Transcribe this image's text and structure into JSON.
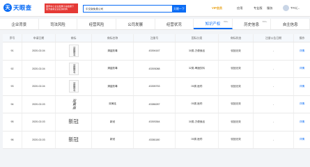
{
  "header": {
    "logo_char": "天",
    "logo_text": "天眼查",
    "promo_line1": "国家中小企业发展子基金旗下",
    "promo_line2": "官方备案企业征信机构",
    "search_value": "中文版免费公司",
    "search_button": "天眼一下",
    "nav": [
      "VIP会员",
      "应用",
      "专业版",
      "服务",
      "我的"
    ],
    "user_name": "TYC(..."
  },
  "tabs": [
    {
      "label": "企业背景",
      "badge": ""
    },
    {
      "label": "司法风险",
      "badge": ""
    },
    {
      "label": "经营风险",
      "badge": ""
    },
    {
      "label": "公司发展",
      "badge": ""
    },
    {
      "label": "经营状况",
      "badge": ""
    },
    {
      "label": "知识产权",
      "badge": "999+"
    },
    {
      "label": "历史信息",
      "badge": "999+"
    },
    {
      "label": "自主信息",
      "badge": ""
    }
  ],
  "active_tab": 5,
  "table": {
    "columns": [
      "序号",
      "申请日期",
      "商标",
      "商标名称",
      "注册号",
      "国际分类",
      "商标状态",
      "注册公告日期",
      "操作"
    ],
    "rows": [
      {
        "index": "91",
        "date": "2020-02-04",
        "mark": "清瘟败毒",
        "mark_style": "box",
        "name": "清瘟败毒",
        "reg": "43394167",
        "cls": "30类-方便食品",
        "status": "驳回无效",
        "notice": "-",
        "action": "详情"
      },
      {
        "index": "92",
        "date": "2020-02-04",
        "mark": "清瘟败毒",
        "mark_style": "box",
        "name": "清瘟败毒",
        "reg": "43393088",
        "cls": "32类-啤酒饮料",
        "status": "驳回无效",
        "notice": "-",
        "action": "详情"
      },
      {
        "index": "93",
        "date": "2020-02-04",
        "mark": "清瘟败毒",
        "mark_style": "box",
        "name": "清瘟败毒",
        "reg": "43395753",
        "cls": "05类-医药",
        "status": "驳回无效",
        "notice": "-",
        "action": "详情"
      },
      {
        "index": "94",
        "date": "2020-02-03",
        "mark": "双黄连",
        "mark_style": "calligraphy",
        "name": "双黄连",
        "reg": "43386287",
        "cls": "05类-医药",
        "status": "驳回无效",
        "notice": "-",
        "action": "详情"
      },
      {
        "index": "95",
        "date": "2020-02-03",
        "mark": "新冠",
        "mark_style": "big",
        "name": "新冠",
        "reg": "43393364",
        "cls": "30类-方便食品",
        "status": "驳回无效",
        "notice": "-",
        "action": "详情"
      },
      {
        "index": "96",
        "date": "2020-02-03",
        "mark": "新冠",
        "mark_style": "big",
        "name": "新冠",
        "reg": "43381180",
        "cls": "05类-医药",
        "status": "驳回无效",
        "notice": "-",
        "action": "详情"
      }
    ]
  },
  "colors": {
    "brand": "#0a6cf5",
    "promo": "#e53935",
    "vip": "#e8a013"
  }
}
